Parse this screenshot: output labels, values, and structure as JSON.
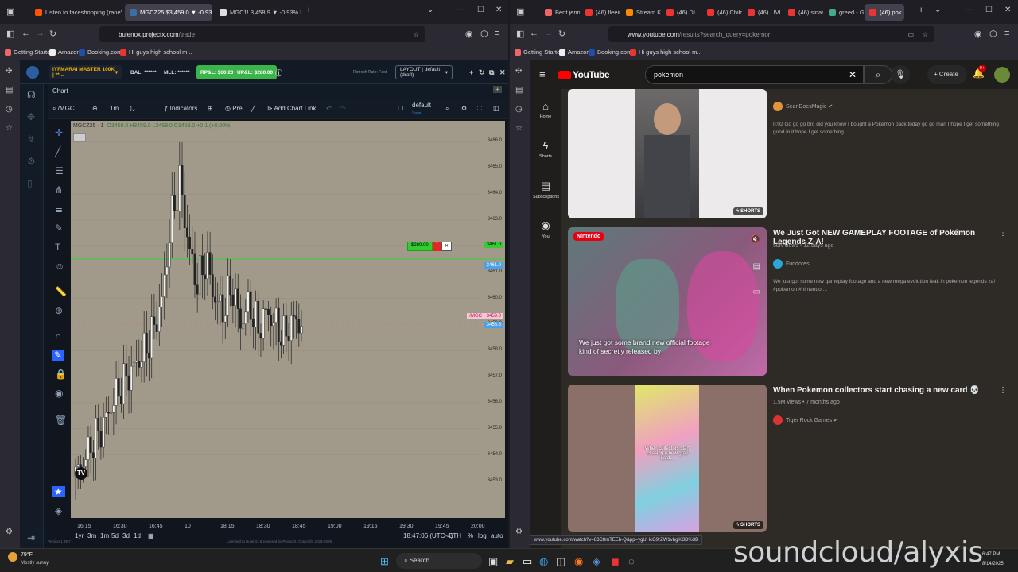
{
  "left": {
    "tabs": [
      {
        "label": "Listen to faceshopping (rane's r",
        "active": false
      },
      {
        "label": "MGCZ25 $3,459.0 ▼ -0.93%",
        "active": true
      },
      {
        "label": "MGC1! 3,458.9 ▼ -0.93% Unnam",
        "active": false
      }
    ],
    "url_host": "bulenox.projectx.com",
    "url_path": "/trade",
    "bookmarks": [
      "Getting Started",
      "Amazon",
      "Booking.com",
      "Hi guys high school m..."
    ],
    "app": {
      "account": "IYFMARAI MASTER 100K | **...",
      "bal": "BAL: ******",
      "mll": "MLL: ******",
      "rpl": "RP&L: $60.20",
      "upl": "UP&L: $280.00",
      "refresh": "Refresh Rate: Fast",
      "layout": "LAYOUT | default (draft)",
      "chart_tab": "Chart",
      "symbol": "/MGC",
      "interval": "1m",
      "indicators": "Indicators",
      "pre": "Pre",
      "add_chart_link": "Add Chart Link",
      "template": "default",
      "template_sub": "Save",
      "ohlc_symbol": "MGCZ25 · 1",
      "ohlc": "O3459.0 H3459.0 L3459.0 C3459.0 +0.1 (+0.00%)",
      "order_price": "$280.00",
      "order_qty": "1",
      "order_line_price": "3461.0",
      "line2_price": "3461.0",
      "last_tag": "/MGC",
      "last_price": "3459.0",
      "bid_price": "3458.8",
      "time_display": "18:47:06 (UTC-4)",
      "exchange": "ETH",
      "pct": "%",
      "log": "log",
      "auto": "auto",
      "ranges": [
        "1yr",
        "3m",
        "1m",
        "5d",
        "3d",
        "1d"
      ],
      "version": "Version 1.39.7",
      "footer": "Licensed to Bulenox & powered by ProjectX. Copyright 2024-2025"
    }
  },
  "chart_data": {
    "type": "candlestick",
    "x_ticks": [
      "16:15",
      "16:30",
      "16:45",
      "10",
      "18:15",
      "18:30",
      "18:45",
      "19:00",
      "19:15",
      "19:30",
      "19:45",
      "20:00"
    ],
    "y_ticks": [
      "3466.0",
      "3465.0",
      "3464.0",
      "3463.0",
      "3462.0",
      "3461.0",
      "3460.0",
      "3459.0",
      "3458.0",
      "3457.0",
      "3456.0",
      "3455.0",
      "3454.0",
      "3453.0"
    ],
    "ylim": [
      3452.5,
      3466.5
    ],
    "close_series": [
      3453.2,
      3453.8,
      3454.5,
      3455.0,
      3455.8,
      3456.5,
      3457.0,
      3457.5,
      3458.0,
      3458.8,
      3460.0,
      3463.0,
      3464.5,
      3462.0,
      3460.5,
      3461.5,
      3460.0,
      3459.5,
      3460.5,
      3459.0,
      3459.8,
      3458.8,
      3459.5,
      3459.0,
      3458.5,
      3459.2,
      3459.0
    ],
    "order_line": 3461.5,
    "last": 3459.0
  },
  "right": {
    "tabs": [
      "Bent jenn c",
      "(46) fleeing",
      "Stream Ken",
      "(46) DI",
      "(46) Childis",
      "(46) LIVI",
      "(46) sinam",
      "greed - Go",
      "(46) pok"
    ],
    "url_host": "www.youtube.com",
    "url_path": "/results?search_query=pokemon",
    "bookmarks": [
      "Getting Started",
      "Amazon",
      "Booking.com",
      "Hi guys high school m..."
    ],
    "yt": {
      "logo": "YouTube",
      "query": "pokemon",
      "create": "Create",
      "notif_count": "9+",
      "nav": [
        "Home",
        "Shorts",
        "Subscriptions",
        "You"
      ],
      "videos": [
        {
          "title": "",
          "channel": "SeanDoesMagic",
          "meta": "",
          "desc": "0:02  Go go go bro did you know I bought a Pokemon pack today go go man I hope I get something good in it hope I get something ...",
          "badge": "SHORTS"
        },
        {
          "title": "We Just Got NEW GAMEPLAY FOOTAGE of Pokémon Legends Z-A!",
          "channel": "Fundores",
          "meta": "58K views • 12 days ago",
          "desc": "We just got some new gameplay footage and a new mega evolution leak in pokemon legends za! #pokemon #nintendo ...",
          "overlay": "We just got some brand new official footage kind of secretly released by",
          "thumb_logo": "Nintendo"
        },
        {
          "title": "When Pokemon collectors start chasing a new card 💀",
          "channel": "Tiger Rock Games",
          "meta": "1.5M views • 7 months ago",
          "desc": "",
          "overlay": "When collectors start chasing a new grail card...",
          "badge": "SHORTS"
        }
      ],
      "status_url": "www.youtube.com/watch?v=83C8mTEEh-Q&pp=ygUHcG9rZW1vbg%3D%3D"
    }
  },
  "taskbar": {
    "weather_temp": "79°F",
    "weather_desc": "Mostly sunny",
    "search": "Search",
    "time": "6:47 PM",
    "date": "8/14/2025"
  },
  "watermark": "soundcloud/alyxis"
}
